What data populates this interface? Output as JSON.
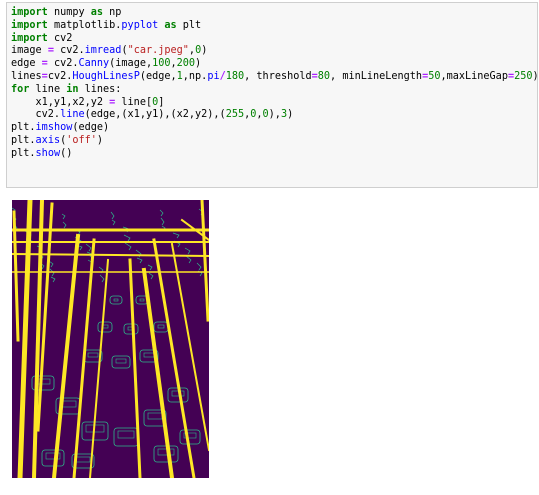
{
  "notebook": {
    "code_lines": [
      [
        [
          "kw",
          "import"
        ],
        [
          "t",
          " numpy "
        ],
        [
          "kw",
          "as"
        ],
        [
          "t",
          " np"
        ]
      ],
      [
        [
          "kw",
          "import"
        ],
        [
          "t",
          " matplotlib."
        ],
        [
          "fn",
          "pyplot"
        ],
        [
          "t",
          " "
        ],
        [
          "kw",
          "as"
        ],
        [
          "t",
          " plt"
        ]
      ],
      [
        [
          "kw",
          "import"
        ],
        [
          "t",
          " cv2"
        ]
      ],
      [
        [
          "t",
          "image "
        ],
        [
          "op",
          "="
        ],
        [
          "t",
          " cv2."
        ],
        [
          "fn",
          "imread"
        ],
        [
          "t",
          "("
        ],
        [
          "str",
          "\"car.jpeg\""
        ],
        [
          "t",
          ","
        ],
        [
          "num",
          "0"
        ],
        [
          "t",
          ")"
        ]
      ],
      [
        [
          "t",
          "edge "
        ],
        [
          "op",
          "="
        ],
        [
          "t",
          " cv2."
        ],
        [
          "fn",
          "Canny"
        ],
        [
          "t",
          "(image,"
        ],
        [
          "num",
          "100"
        ],
        [
          "t",
          ","
        ],
        [
          "num",
          "200"
        ],
        [
          "t",
          ")"
        ]
      ],
      [
        [
          "t",
          "lines"
        ],
        [
          "op",
          "="
        ],
        [
          "t",
          "cv2."
        ],
        [
          "fn",
          "HoughLinesP"
        ],
        [
          "t",
          "(edge,"
        ],
        [
          "num",
          "1"
        ],
        [
          "t",
          ",np."
        ],
        [
          "fn",
          "pi"
        ],
        [
          "op",
          "/"
        ],
        [
          "num",
          "180"
        ],
        [
          "t",
          ", threshold"
        ],
        [
          "op",
          "="
        ],
        [
          "num",
          "80"
        ],
        [
          "t",
          ", minLineLength"
        ],
        [
          "op",
          "="
        ],
        [
          "num",
          "50"
        ],
        [
          "t",
          ",maxLineGap"
        ],
        [
          "op",
          "="
        ],
        [
          "num",
          "250"
        ],
        [
          "t",
          ")"
        ]
      ],
      [
        [
          "kw",
          "for"
        ],
        [
          "t",
          " line "
        ],
        [
          "kw",
          "in"
        ],
        [
          "t",
          " lines:"
        ]
      ],
      [
        [
          "t",
          "    x1,y1,x2,y2 "
        ],
        [
          "op",
          "="
        ],
        [
          "t",
          " line["
        ],
        [
          "num",
          "0"
        ],
        [
          "t",
          "]"
        ]
      ],
      [
        [
          "t",
          "    cv2."
        ],
        [
          "fn",
          "line"
        ],
        [
          "t",
          "(edge,(x1,y1),(x2,y2),("
        ],
        [
          "num",
          "255"
        ],
        [
          "t",
          ","
        ],
        [
          "num",
          "0"
        ],
        [
          "t",
          ","
        ],
        [
          "num",
          "0"
        ],
        [
          "t",
          "),"
        ],
        [
          "num",
          "3"
        ],
        [
          "t",
          ")"
        ]
      ],
      [
        [
          "t",
          "plt."
        ],
        [
          "fn",
          "imshow"
        ],
        [
          "t",
          "(edge)"
        ]
      ],
      [
        [
          "t",
          "plt."
        ],
        [
          "fn",
          "axis"
        ],
        [
          "t",
          "("
        ],
        [
          "str",
          "'off'"
        ],
        [
          "t",
          ")"
        ]
      ],
      [
        [
          "t",
          "plt."
        ],
        [
          "fn",
          "show"
        ],
        [
          "t",
          "()"
        ]
      ]
    ],
    "output_image": {
      "description": "edge-detection",
      "background_color": "#440154",
      "edge_color": "#2db88a",
      "line_color": "#fde725"
    }
  }
}
